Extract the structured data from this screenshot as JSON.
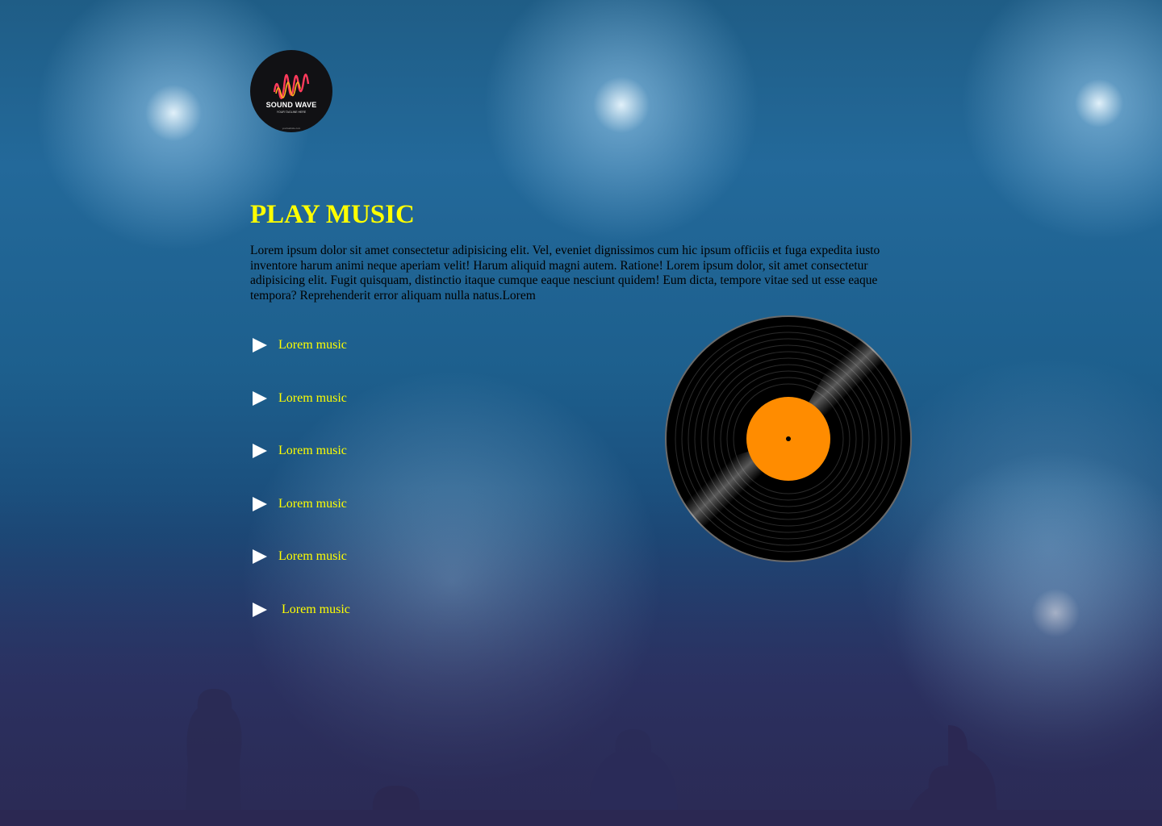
{
  "brand": {
    "logo_title": "SOUND WAVE",
    "logo_tagline": "YOUR TAGLINE HERE",
    "logo_footer": "yourwebsite.com",
    "logo_icon": "sound-wave-icon"
  },
  "hero": {
    "title": "PLAY MUSIC",
    "description": "Lorem ipsum dolor sit amet consectetur adipisicing elit. Vel, eveniet dignissimos cum hic ipsum officiis et fuga expedita iusto inventore harum animi neque aperiam velit! Harum aliquid magni autem. Ratione! Lorem ipsum dolor, sit amet consectetur adipisicing elit. Fugit quisquam, distinctio itaque cumque eaque nesciunt quidem! Eum dicta, tempore vitae sed ut esse eaque tempora? Reprehenderit error aliquam nulla natus.Lorem"
  },
  "tracks": [
    {
      "label": "Lorem music",
      "icon": "play-icon"
    },
    {
      "label": "Lorem music",
      "icon": "play-icon"
    },
    {
      "label": "Lorem music",
      "icon": "play-icon"
    },
    {
      "label": "Lorem music",
      "icon": "play-icon"
    },
    {
      "label": "Lorem music",
      "icon": "play-icon"
    },
    {
      "label": "Lorem music",
      "icon": "play-icon"
    }
  ],
  "colors": {
    "accent": "#ffff00",
    "record_label": "#ff8c00",
    "record": "#000000"
  },
  "record_icon": "vinyl-record-icon"
}
